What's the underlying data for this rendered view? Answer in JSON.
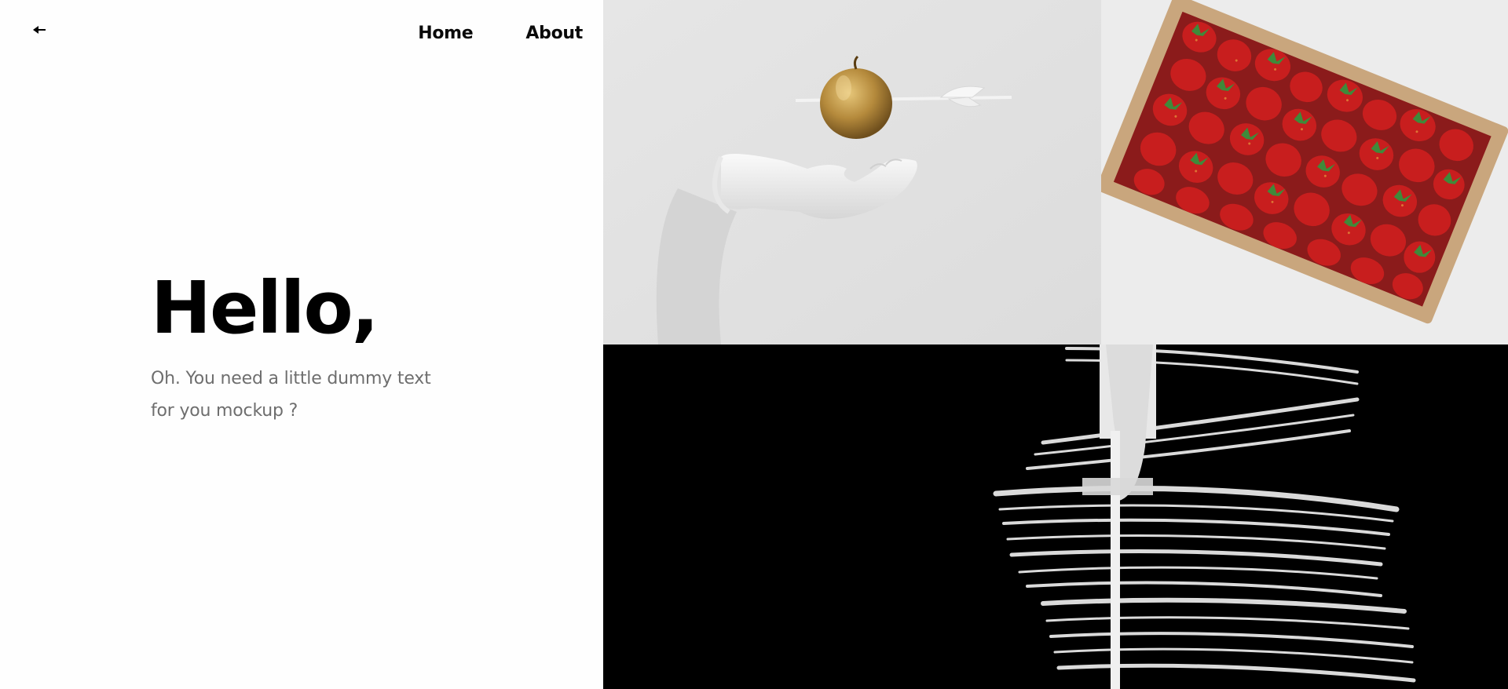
{
  "nav": {
    "back_icon": "arrow-left-icon",
    "items": [
      {
        "label": "Home"
      },
      {
        "label": "About"
      }
    ]
  },
  "hero": {
    "title": "Hello,",
    "subtitle": "Oh. You need a little dummy text for you mockup ?"
  },
  "gallery": {
    "images": [
      {
        "subject": "golden apple pierced by arrow above white sculpted hand"
      },
      {
        "subject": "cardboard box of strawberries"
      },
      {
        "subject": "white brush strokes on black"
      }
    ]
  },
  "colors": {
    "text": "#000000",
    "muted": "#6e6e6e",
    "gold": "#b58a3c",
    "strawberry": "#c81e1e",
    "leaf": "#3f8a3a"
  }
}
